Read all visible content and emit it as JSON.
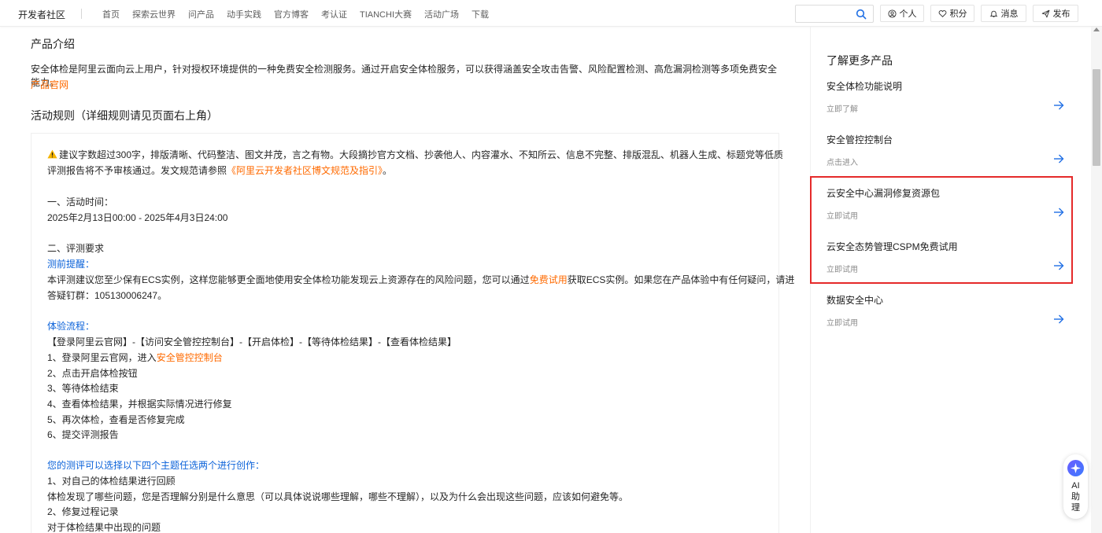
{
  "header": {
    "brand": "开发者社区",
    "nav": [
      "首页",
      "探索云世界",
      "问产品",
      "动手实践",
      "官方博客",
      "考认证",
      "TIANCHI大赛",
      "活动广场",
      "下载"
    ],
    "buttons": {
      "personal": "个人",
      "points": "积分",
      "messages": "消息",
      "publish": "发布"
    }
  },
  "main": {
    "intro_title": "产品介绍",
    "intro_text": "安全体检是阿里云面向云上用户，针对授权环境提供的一种免费安全检测服务。通过开启安全体检服务，可以获得涵盖安全攻击告警、风险配置检测、高危漏洞检测等多项免费安全能力。",
    "intro_link": "产品官网",
    "rules_title": "活动规则（详细规则请见页面右上角）",
    "rules": {
      "notice_part1": "建议字数超过300字，排版清晰、代码整洁、图文并茂，言之有物。大段摘抄官方文档、抄袭他人、内容灌水、不知所云、信息不完整、排版混乱、机器人生成、标题党等低质",
      "notice_part2": "评测报告将不予审核通过。发文规范请参照",
      "notice_link": "《阿里云开发者社区博文规范及指引》",
      "notice_end": "。",
      "time_heading": "一、活动时间：",
      "time_value": "2025年2月13日00:00 - 2025年4月3日24:00",
      "req_heading": "二、评测要求",
      "pre_heading": "测前提醒：",
      "pre_text1": "本评测建议您至少保有ECS实例，这样您能够更全面地使用安全体检功能发现云上资源存在的风险问题，您可以通过",
      "pre_link": "免费试用",
      "pre_text2": "获取ECS实例。如果您在产品体验中有任何疑问，请进",
      "pre_text3": "答疑钉群：105130006247。",
      "flow_heading": "体验流程：",
      "flow_summary": "【登录阿里云官网】-【访问安全管控控制台】-【开启体检】-【等待体检结果】-【查看体检结果】",
      "step1_text": "1、登录阿里云官网，进入",
      "step1_link": "安全管控控制台",
      "step2": "2、点击开启体检按钮",
      "step3": "3、等待体检结束",
      "step4": "4、查看体检结果，并根据实际情况进行修复",
      "step5": "5、再次体检，查看是否修复完成",
      "step6": "6、提交评测报告",
      "topic_heading": "您的测评可以选择以下四个主题任选两个进行创作：",
      "topic1": "1、对自己的体检结果进行回顾",
      "topic1_desc": "体检发现了哪些问题，您是否理解分别是什么意思（可以具体说说哪些理解，哪些不理解），以及为什么会出现这些问题，应该如何避免等。",
      "topic2": "2、修复过程记录",
      "topic2_desc": "对于体检结果中出现的问题"
    }
  },
  "side": {
    "title": "了解更多产品",
    "items": [
      {
        "name": "安全体检功能说明",
        "action": "立即了解"
      },
      {
        "name": "安全管控控制台",
        "action": "点击进入"
      },
      {
        "name": "云安全中心漏洞修复资源包",
        "action": "立即试用"
      },
      {
        "name": "云安全态势管理CSPM免费试用",
        "action": "立即试用"
      },
      {
        "name": "数据安全中心",
        "action": "立即试用"
      }
    ]
  },
  "ai_assistant": {
    "label_line1": "AI",
    "label_line2": "助",
    "label_line3": "理"
  },
  "colors": {
    "link_orange": "#ff6a00",
    "heading_blue": "#0b62d9",
    "highlight_red": "#e52a2a",
    "arrow_blue": "#1f6fe5"
  }
}
